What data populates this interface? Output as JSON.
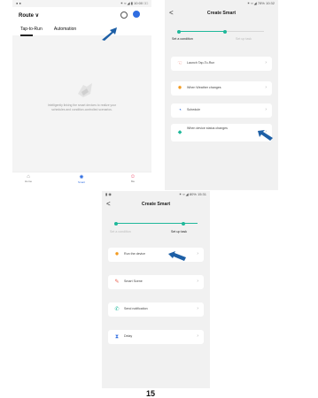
{
  "page_number": "15",
  "phone1": {
    "status_left": "● ●",
    "status_right": "✶ ¤ ◢ ▮ 10:00 □□",
    "title": "Route ∨",
    "tabs": [
      "Tap-to-Run",
      "Automation"
    ],
    "empty_text_line1": "Intelligently linking the smart devices to realize your",
    "empty_text_line2": "schedules and condition-controlled scenarios.",
    "nav": [
      "Home",
      "Smart",
      "Me"
    ]
  },
  "phone2": {
    "status_right": "✶ ¤ ◢ 78% 10:32",
    "back": "<",
    "title": "Create Smart",
    "step1": "Set a condition",
    "step2": "Set up task",
    "options": [
      {
        "label": "Launch Tap-To-Run",
        "icon": "hand-icon"
      },
      {
        "label": "When Weather changes",
        "icon": "sun-icon"
      },
      {
        "label": "Schedule",
        "icon": "clock-icon"
      },
      {
        "label": "When device status changes",
        "icon": "device-icon"
      }
    ]
  },
  "phone3": {
    "status_left": "▮ ◉",
    "status_right": "✶ ¤ ◢ 80% 15:31",
    "back": "<",
    "title": "Create Smart",
    "step1": "Set a condition",
    "step2": "Set up task",
    "options": [
      {
        "label": "Run the device",
        "icon": "sun-icon"
      },
      {
        "label": "Smart Scene",
        "icon": "scene-icon"
      },
      {
        "label": "Send notification",
        "icon": "notify-icon"
      },
      {
        "label": "Delay",
        "icon": "hourglass-icon"
      }
    ]
  },
  "colors": {
    "accent": "#1fb89a",
    "blue": "#2f6de1",
    "arrow": "#1d5fa6",
    "orange": "#f39a1e"
  }
}
